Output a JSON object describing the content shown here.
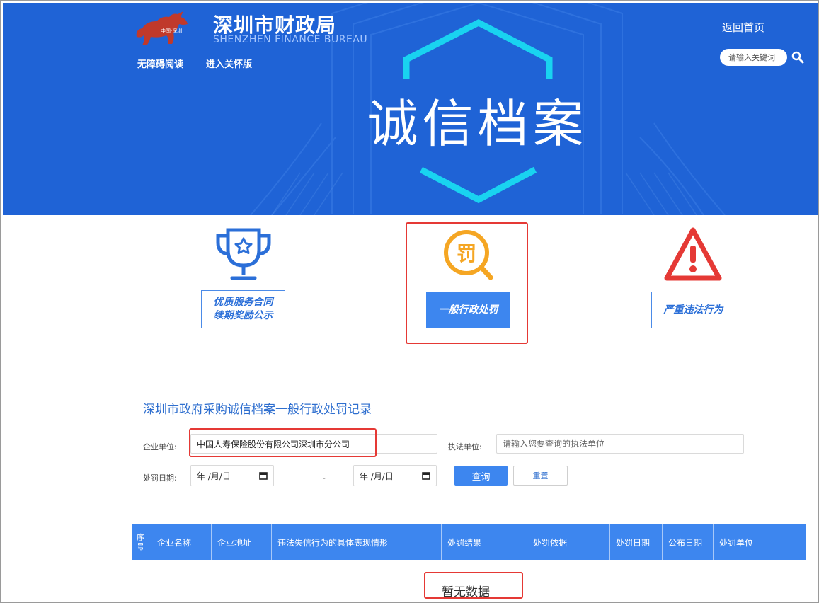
{
  "header": {
    "site_title": "深圳市财政局",
    "site_subtitle": "SHENZHEN FINANCE BUREAU",
    "logo_text": "中国·深圳",
    "links": {
      "accessible_reading": "无障碍阅读",
      "care_mode": "进入关怀版",
      "home": "返回首页"
    },
    "search": {
      "placeholder": "请输入关键词",
      "icon": "search-icon"
    },
    "banner_title": "诚信档案",
    "colors": {
      "banner_blue": "#1f63d6",
      "accent_cyan": "#19d3f0"
    }
  },
  "categories": [
    {
      "label_line1": "优质服务合同",
      "label_line2": "续期奖励公示",
      "icon": "trophy-icon",
      "icon_color": "#2b6fd8",
      "active": false
    },
    {
      "label_line1": "一般行政处罚",
      "label_line2": "",
      "icon": "penalty-search-icon",
      "icon_char": "罚",
      "icon_color": "#f5a623",
      "active": true
    },
    {
      "label_line1": "严重违法行为",
      "label_line2": "",
      "icon": "warning-triangle-icon",
      "icon_color": "#e53935",
      "active": false
    }
  ],
  "form": {
    "section_title": "深圳市政府采购诚信档案一般行政处罚记录",
    "company_label": "企业单位:",
    "company_value": "中国人寿保险股份有限公司深圳市分公司",
    "agency_label": "执法单位:",
    "agency_placeholder": "请输入您要查询的执法单位",
    "date_label": "处罚日期:",
    "date_start": "年 /月/日",
    "date_end": "年 /月/日",
    "date_separator": "~",
    "query_button": "查询",
    "reset_button": "重置",
    "accent_color": "#3d86ef"
  },
  "table": {
    "columns": [
      "序号",
      "企业名称",
      "企业地址",
      "违法失信行为的具体表现情形",
      "处罚结果",
      "处罚依据",
      "处罚日期",
      "公布日期",
      "处罚单位"
    ],
    "empty_text": "暂无数据"
  }
}
